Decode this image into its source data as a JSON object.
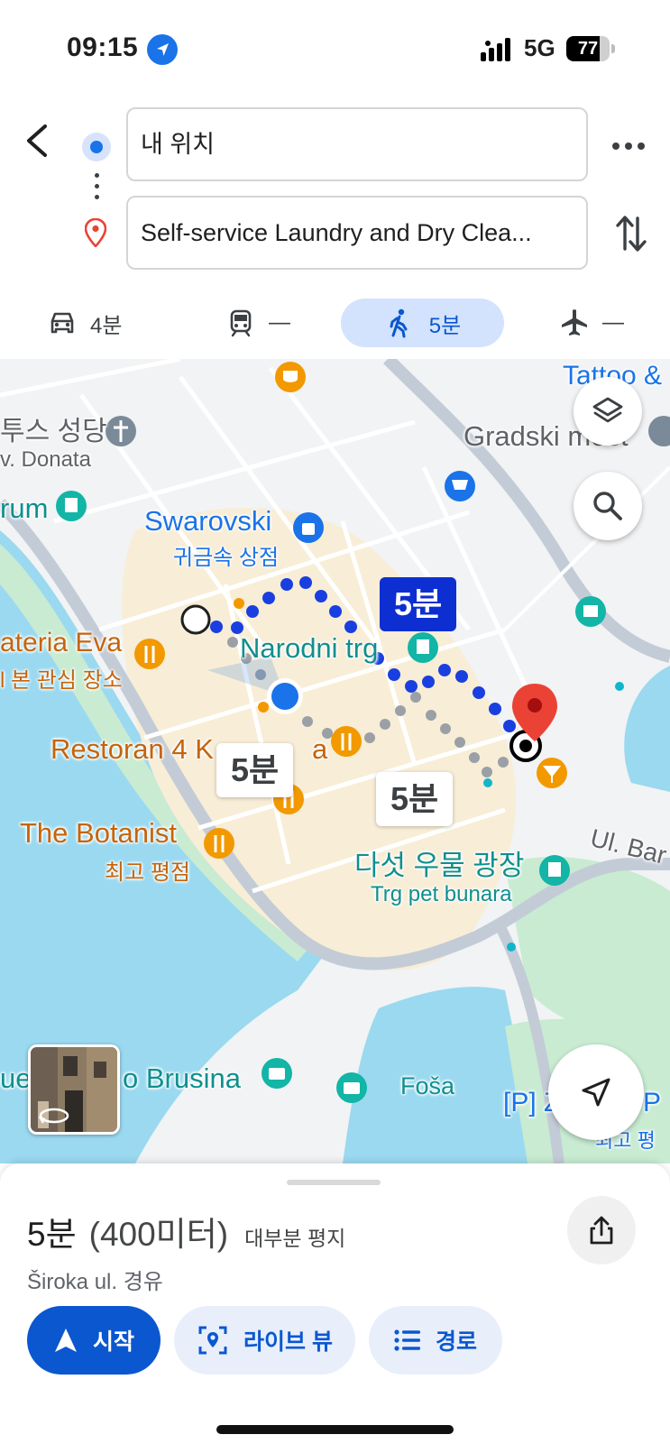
{
  "status_bar": {
    "time": "09:15",
    "network": "5G",
    "battery": "77",
    "battery_level": 0.77
  },
  "route": {
    "origin_value": "내 위치",
    "destination_value": "Self-service Laundry and Dry Clea..."
  },
  "modes": [
    {
      "name": "drive",
      "icon": "car-icon",
      "label": "4분"
    },
    {
      "name": "transit",
      "icon": "train-icon",
      "label": "—"
    },
    {
      "name": "walk",
      "icon": "walking-icon",
      "label": "5분",
      "selected": true
    },
    {
      "name": "flight",
      "icon": "airplane-icon",
      "label": "—"
    }
  ],
  "map": {
    "labels": {
      "tattoo": "Tattoo &",
      "cathedral_ko": "투스 성당",
      "cathedral_en": "v. Donata",
      "gradski": "Gradski most",
      "forum": "rum",
      "swarovski": "Swarovski",
      "swarovski_sub": "귀금속 상점",
      "gelateria": "ateria Eva",
      "gelateria_sub": "l 본 관심 장소",
      "narodni": "Narodni trg",
      "restoran": "Restoran 4 K",
      "restoran_end": "a",
      "botanist": "The Botanist",
      "botanist_sub": "최고 평점",
      "five_wells_ko": "다섯 우물 광장",
      "five_wells_en": "Trg pet bunara",
      "ul_bar": "Ul. Bar",
      "brusina_left": "ue",
      "brusina": "o Brusina",
      "fosa": "Foša",
      "zadar_p": "[P] ZADAR P",
      "zadar_sub": "최고 평"
    },
    "time_chips": {
      "main": "5분",
      "alt_left": "5분",
      "alt_right": "5분"
    }
  },
  "summary": {
    "duration": "5분",
    "distance": "(400미터)",
    "note": "대부분 평지",
    "via": "Široka ul. 경유"
  },
  "actions": {
    "start": "시작",
    "live_view": "라이브 뷰",
    "steps": "경로"
  },
  "colors": {
    "accent": "#0b57d0",
    "route_blue": "#1a3fe0",
    "alt_route_gray": "#9aa0a6",
    "destination_red": "#ea4335",
    "water": "#9ad9f0",
    "park": "#c8ebd2"
  }
}
